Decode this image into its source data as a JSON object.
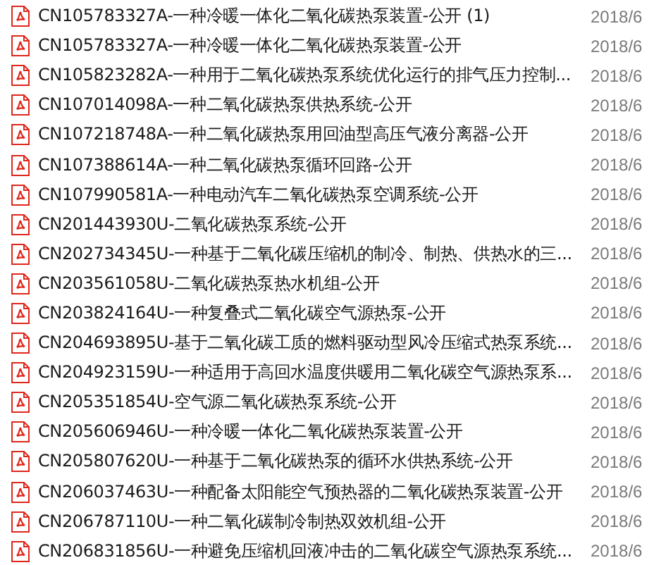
{
  "files": [
    {
      "name": "CN105783327A-一种冷暖一体化二氧化碳热泵装置-公开 (1)",
      "date": "2018/6"
    },
    {
      "name": "CN105783327A-一种冷暖一体化二氧化碳热泵装置-公开",
      "date": "2018/6"
    },
    {
      "name": "CN105823282A-一种用于二氧化碳热泵系统优化运行的排气压力控制...",
      "date": "2018/6"
    },
    {
      "name": "CN107014098A-一种二氧化碳热泵供热系统-公开",
      "date": "2018/6"
    },
    {
      "name": "CN107218748A-一种二氧化碳热泵用回油型高压气液分离器-公开",
      "date": "2018/6"
    },
    {
      "name": "CN107388614A-一种二氧化碳热泵循环回路-公开",
      "date": "2018/6"
    },
    {
      "name": "CN107990581A-一种电动汽车二氧化碳热泵空调系统-公开",
      "date": "2018/6"
    },
    {
      "name": "CN201443930U-二氧化碳热泵系统-公开",
      "date": "2018/6"
    },
    {
      "name": "CN202734345U-一种基于二氧化碳压缩机的制冷、制热、供热水的三...",
      "date": "2018/6"
    },
    {
      "name": "CN203561058U-二氧化碳热泵热水机组-公开",
      "date": "2018/6"
    },
    {
      "name": "CN203824164U-一种复叠式二氧化碳空气源热泵-公开",
      "date": "2018/6"
    },
    {
      "name": "CN204693895U-基于二氧化碳工质的燃料驱动型风冷压缩式热泵系统...",
      "date": "2018/6"
    },
    {
      "name": "CN204923159U-一种适用于高回水温度供暖用二氧化碳空气源热泵系...",
      "date": "2018/6"
    },
    {
      "name": "CN205351854U-空气源二氧化碳热泵系统-公开",
      "date": "2018/6"
    },
    {
      "name": "CN205606946U-一种冷暖一体化二氧化碳热泵装置-公开",
      "date": "2018/6"
    },
    {
      "name": "CN205807620U-一种基于二氧化碳热泵的循环水供热系统-公开",
      "date": "2018/6"
    },
    {
      "name": "CN206037463U-一种配备太阳能空气预热器的二氧化碳热泵装置-公开",
      "date": "2018/6"
    },
    {
      "name": "CN206787110U-一种二氧化碳制冷制热双效机组-公开",
      "date": "2018/6"
    },
    {
      "name": "CN206831856U-一种避免压缩机回液冲击的二氧化碳空气源热泵系统...",
      "date": "2018/6"
    }
  ]
}
